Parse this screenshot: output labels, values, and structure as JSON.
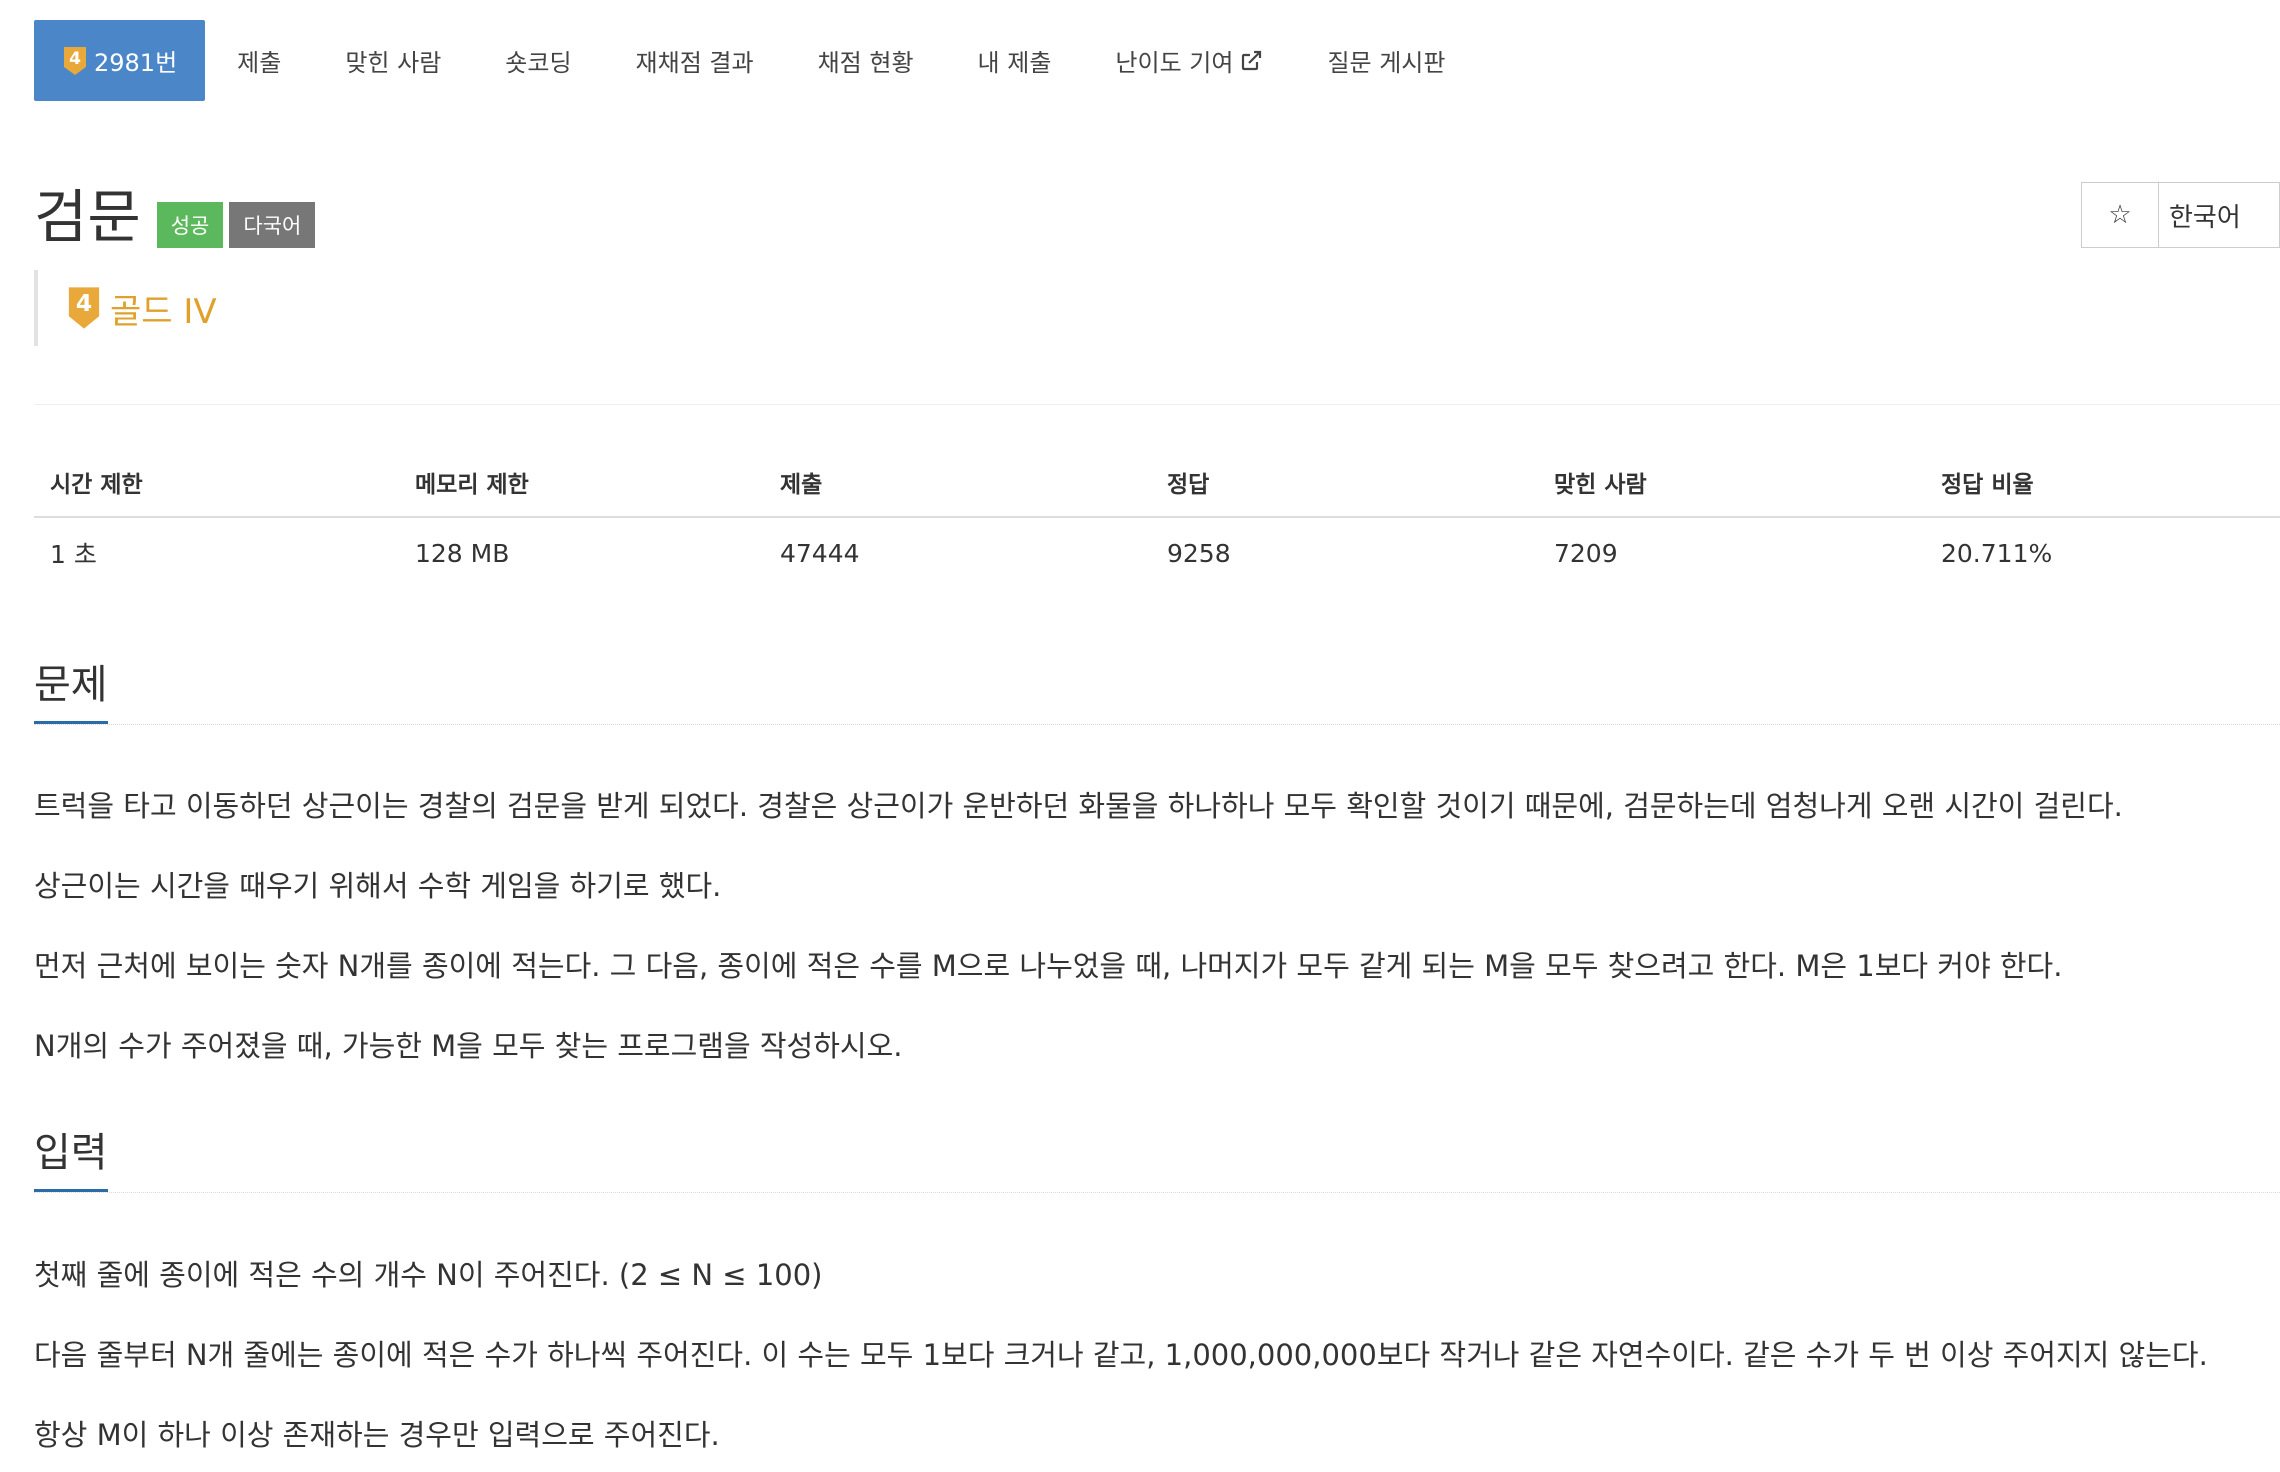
{
  "tabs": [
    {
      "label": "2981번",
      "active": true
    },
    {
      "label": "제출"
    },
    {
      "label": "맞힌 사람"
    },
    {
      "label": "숏코딩"
    },
    {
      "label": "재채점 결과"
    },
    {
      "label": "채점 현황"
    },
    {
      "label": "내 제출"
    },
    {
      "label": "난이도 기여"
    },
    {
      "label": "질문 게시판"
    }
  ],
  "tier_icon_number": "4",
  "problem": {
    "title": "검문",
    "labels": [
      "성공",
      "다국어"
    ],
    "tier": "골드 IV"
  },
  "right_buttons": {
    "star": "☆",
    "language": "한국어"
  },
  "stats": {
    "headers": [
      "시간 제한",
      "메모리 제한",
      "제출",
      "정답",
      "맞힌 사람",
      "정답 비율"
    ],
    "values": [
      "1 초",
      "128 MB",
      "47444",
      "9258",
      "7209",
      "20.711%"
    ]
  },
  "sections": {
    "problem": {
      "heading": "문제",
      "paragraphs": [
        "트럭을 타고 이동하던 상근이는 경찰의 검문을 받게 되었다. 경찰은 상근이가 운반하던 화물을 하나하나 모두 확인할 것이기 때문에, 검문하는데 엄청나게 오랜 시간이 걸린다.",
        "상근이는 시간을 때우기 위해서 수학 게임을 하기로 했다.",
        "먼저 근처에 보이는 숫자 N개를 종이에 적는다. 그 다음, 종이에 적은 수를 M으로 나누었을 때, 나머지가 모두 같게 되는 M을 모두 찾으려고 한다. M은 1보다 커야 한다.",
        "N개의 수가 주어졌을 때, 가능한 M을 모두 찾는 프로그램을 작성하시오."
      ]
    },
    "input": {
      "heading": "입력",
      "paragraphs": [
        "첫째 줄에 종이에 적은 수의 개수 N이 주어진다. (2 ≤ N ≤ 100)",
        "다음 줄부터 N개 줄에는 종이에 적은 수가 하나씩 주어진다. 이 수는 모두 1보다 크거나 같고, 1,000,000,000보다 작거나 같은 자연수이다. 같은 수가 두 번 이상 주어지지 않는다.",
        "항상 M이 하나 이상 존재하는 경우만 입력으로 주어진다."
      ]
    }
  },
  "colors": {
    "active_tab": "#4a86c8",
    "success": "#5cb85c",
    "multilang": "#777777",
    "gold": "#e0a02c",
    "section_underline": "#2a6ba8"
  }
}
